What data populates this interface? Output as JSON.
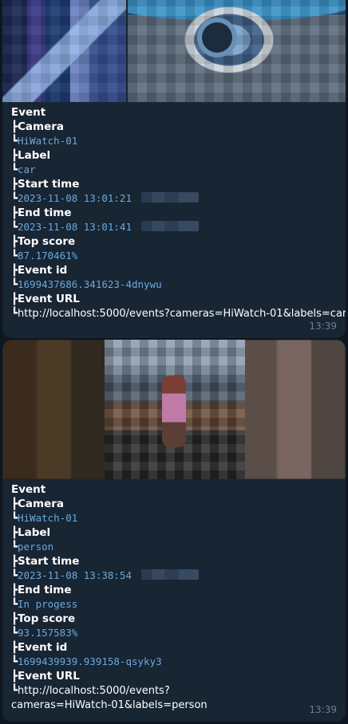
{
  "messages": [
    {
      "event_label": "Event",
      "fields": {
        "camera": {
          "label": "Camera",
          "value": "HiWatch-01"
        },
        "label": {
          "label": "Label",
          "value": "car"
        },
        "start_time": {
          "label": "Start time",
          "value": "2023-11-08 13:01:21"
        },
        "end_time": {
          "label": "End time",
          "value": "2023-11-08 13:01:41"
        },
        "top_score": {
          "label": "Top score",
          "value": "87.170461%"
        },
        "event_id": {
          "label": "Event id",
          "value": "1699437686.341623-4dnywu"
        },
        "event_url": {
          "label": "Event URL",
          "value": "http://localhost:5000/events?cameras=HiWatch-01&labels=car"
        }
      },
      "time": "13:39"
    },
    {
      "event_label": "Event",
      "fields": {
        "camera": {
          "label": "Camera",
          "value": "HiWatch-01"
        },
        "label": {
          "label": "Label",
          "value": "person"
        },
        "start_time": {
          "label": "Start time",
          "value": "2023-11-08 13:38:54"
        },
        "end_time": {
          "label": "End time",
          "value": "In progess"
        },
        "top_score": {
          "label": "Top score",
          "value": "93.157583%"
        },
        "event_id": {
          "label": "Event id",
          "value": "1699439939.939158-qsyky3"
        },
        "event_url": {
          "label": "Event URL",
          "value_line1": "http://localhost:5000/events?",
          "value_line2": "cameras=HiWatch-01&labels=person"
        }
      },
      "time": "13:39"
    }
  ],
  "glyphs": {
    "branch": "┣",
    "leaf": "┗"
  },
  "colors": {
    "background": "#0e1621",
    "bubble": "#182533",
    "code_text": "#6ba9dc",
    "timestamp": "#6d7f8f"
  }
}
